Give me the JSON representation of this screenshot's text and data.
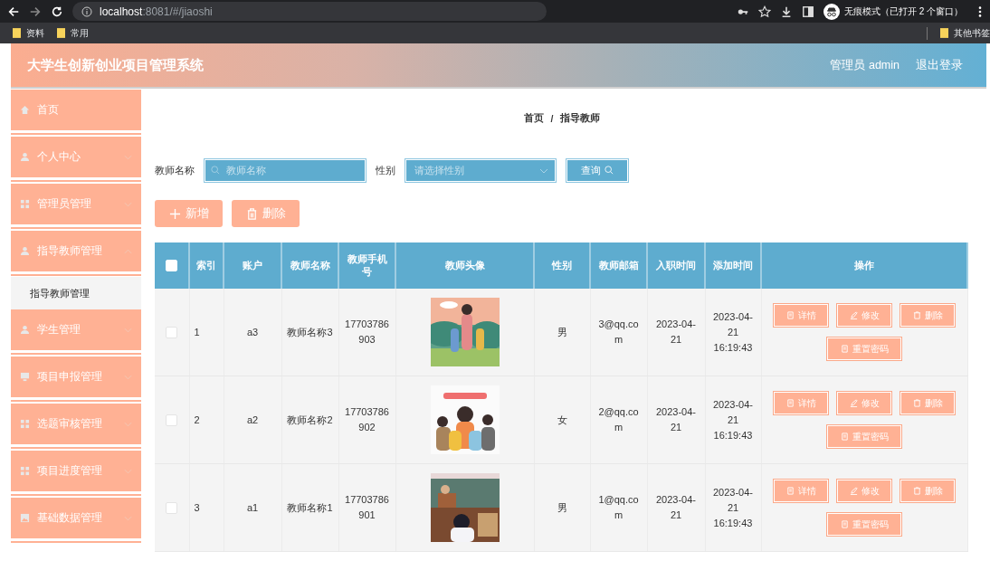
{
  "browser": {
    "address_host": "localhost",
    "address_path": ":8081/#/jiaoshi",
    "incognito": "无痕模式（已打开 2 个窗口）",
    "bookmarks": [
      "资料",
      "常用"
    ],
    "other_bookmarks": "其他书签"
  },
  "header": {
    "title": "大学生创新创业项目管理系统",
    "user": "管理员 admin",
    "logout": "退出登录"
  },
  "sidebar": {
    "items": [
      {
        "label": "首页",
        "kind": "link"
      },
      {
        "label": "个人中心",
        "kind": "menu",
        "expanded": false
      },
      {
        "label": "管理员管理",
        "kind": "menu",
        "expanded": false
      },
      {
        "label": "指导教师管理",
        "kind": "menu",
        "expanded": true,
        "children": [
          {
            "label": "指导教师管理",
            "selected": true
          }
        ]
      },
      {
        "label": "学生管理",
        "kind": "menu",
        "expanded": false
      },
      {
        "label": "项目申报管理",
        "kind": "menu",
        "expanded": false
      },
      {
        "label": "选题审核管理",
        "kind": "menu",
        "expanded": false
      },
      {
        "label": "项目进度管理",
        "kind": "menu",
        "expanded": false
      },
      {
        "label": "基础数据管理",
        "kind": "menu",
        "expanded": false
      }
    ]
  },
  "breadcrumb": {
    "items": [
      "首页",
      "指导教师"
    ],
    "separator": "/"
  },
  "search": {
    "name_label": "教师名称",
    "name_placeholder": "教师名称",
    "gender_label": "性别",
    "gender_placeholder": "请选择性别",
    "query_button": "查询"
  },
  "actions": [
    {
      "label": "新增",
      "kind": "add"
    },
    {
      "label": "删除",
      "kind": "delete"
    }
  ],
  "table": {
    "select_all_checked": false,
    "columns": [
      "索引",
      "账户",
      "教师名称",
      "教师手机号",
      "教师头像",
      "性别",
      "教师邮箱",
      "入职时间",
      "添加时间",
      "操作"
    ],
    "rows": [
      {
        "checked": false,
        "index": "1",
        "account": "a3",
        "name": "教师名称3",
        "phone": "17703786903",
        "gender": "男",
        "email": "3@qq.com",
        "hire_date": "2023-04-21",
        "added_time": "2023-04-21 16:19:43",
        "actions": [
          {
            "label": "详情",
            "kind": "detail"
          },
          {
            "label": "修改",
            "kind": "edit"
          },
          {
            "label": "删除",
            "kind": "delete"
          },
          {
            "label": "重置密码",
            "kind": "reset"
          }
        ]
      },
      {
        "checked": false,
        "index": "2",
        "account": "a2",
        "name": "教师名称2",
        "phone": "17703786902",
        "gender": "女",
        "email": "2@qq.com",
        "hire_date": "2023-04-21",
        "added_time": "2023-04-21 16:19:43",
        "actions": [
          {
            "label": "详情",
            "kind": "detail"
          },
          {
            "label": "修改",
            "kind": "edit"
          },
          {
            "label": "删除",
            "kind": "delete"
          },
          {
            "label": "重置密码",
            "kind": "reset"
          }
        ]
      },
      {
        "checked": false,
        "index": "3",
        "account": "a1",
        "name": "教师名称1",
        "phone": "17703786901",
        "gender": "男",
        "email": "1@qq.com",
        "hire_date": "2023-04-21",
        "added_time": "2023-04-21 16:19:43",
        "actions": [
          {
            "label": "详情",
            "kind": "detail"
          },
          {
            "label": "修改",
            "kind": "edit"
          },
          {
            "label": "删除",
            "kind": "delete"
          },
          {
            "label": "重置密码",
            "kind": "reset"
          }
        ]
      }
    ]
  }
}
